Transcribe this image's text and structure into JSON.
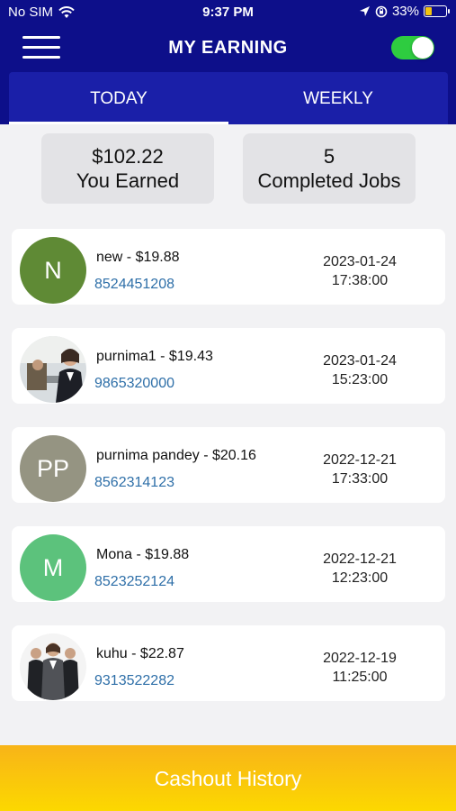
{
  "status_bar": {
    "carrier": "No SIM",
    "time": "9:37 PM",
    "battery": "33%",
    "battery_level": 0.33,
    "icons": [
      "wifi-icon",
      "location-icon",
      "orientation-lock-icon",
      "battery-icon"
    ]
  },
  "header": {
    "title": "MY EARNING",
    "toggle_on": true,
    "menu_icon": "hamburger-icon"
  },
  "tabs": [
    {
      "label": "TODAY",
      "active": true
    },
    {
      "label": "WEEKLY",
      "active": false
    }
  ],
  "summary": {
    "earned_amount": "$102.22",
    "earned_label": "You Earned",
    "jobs_count": "5",
    "jobs_label": "Completed Jobs"
  },
  "jobs": [
    {
      "title": "new - $19.88",
      "phone": "8524451208",
      "date": "2023-01-24",
      "time": "17:38:00",
      "avatar": {
        "type": "initials",
        "text": "N",
        "color": "#5f8a35"
      }
    },
    {
      "title": "purnima1 - $19.43",
      "phone": "9865320000",
      "date": "2023-01-24",
      "time": "15:23:00",
      "avatar": {
        "type": "photo",
        "text": ""
      }
    },
    {
      "title": "purnima pandey - $20.16",
      "phone": "8562314123",
      "date": "2022-12-21",
      "time": "17:33:00",
      "avatar": {
        "type": "initials",
        "text": "PP",
        "color": "#959482"
      }
    },
    {
      "title": "Mona - $19.88",
      "phone": "8523252124",
      "date": "2022-12-21",
      "time": "12:23:00",
      "avatar": {
        "type": "initials",
        "text": "M",
        "color": "#5cc27c"
      }
    },
    {
      "title": "kuhu - $22.87",
      "phone": "9313522282",
      "date": "2022-12-19",
      "time": "11:25:00",
      "avatar": {
        "type": "photo",
        "text": ""
      }
    }
  ],
  "footer": {
    "cashout_label": "Cashout History"
  },
  "colors": {
    "header_bg": "#0d0f8a",
    "tab_bg": "#1a1fa8",
    "phone_link": "#2e6fa8",
    "toggle": "#2ecc40",
    "cashout_gradient_top": "#f8b418",
    "cashout_gradient_bottom": "#fcd800"
  }
}
